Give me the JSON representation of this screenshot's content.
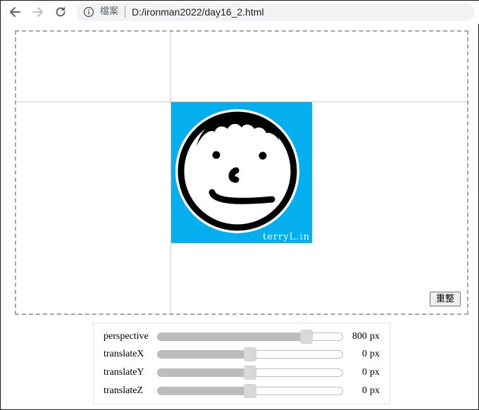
{
  "browser": {
    "security_label": "檔案",
    "url": "D:/ironman2022/day16_2.html",
    "icons": {
      "back": "back-arrow-icon",
      "forward": "forward-arrow-icon",
      "reload": "reload-icon",
      "info": "info-icon"
    }
  },
  "stage": {
    "avatar_watermark": "terryL.in",
    "avatar_background": "#04aeef",
    "reset_label": "重整"
  },
  "controls": [
    {
      "label": "perspective",
      "value": "800",
      "unit": "px",
      "fraction": 0.806
    },
    {
      "label": "translateX",
      "value": "0",
      "unit": "px",
      "fraction": 0.5
    },
    {
      "label": "translateY",
      "value": "0",
      "unit": "px",
      "fraction": 0.5
    },
    {
      "label": "translateZ",
      "value": "0",
      "unit": "px",
      "fraction": 0.5
    }
  ]
}
